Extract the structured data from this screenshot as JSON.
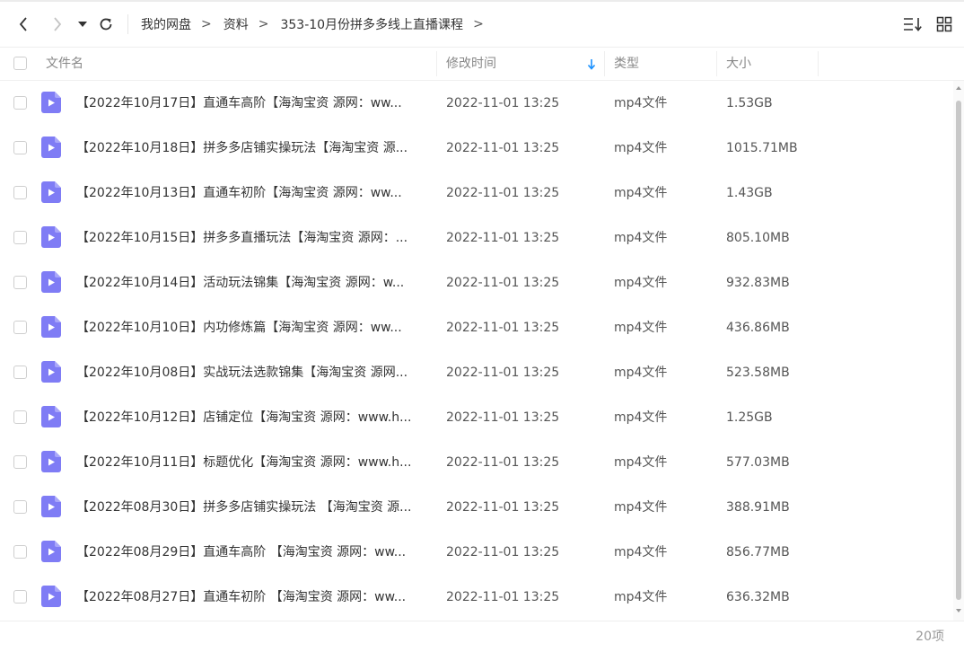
{
  "breadcrumb": [
    "我的网盘",
    "资料",
    "353-10月份拼多多线上直播课程"
  ],
  "breadcrumb_separator": ">",
  "columns": {
    "name": "文件名",
    "modified": "修改时间",
    "type": "类型",
    "size": "大小"
  },
  "sort": {
    "column": "modified",
    "direction": "descending"
  },
  "colors": {
    "accent": "#1890ff",
    "file_icon": "#7f7cf5",
    "text": "#333333",
    "muted": "#888888"
  },
  "icons": {
    "back": "chevron-left-icon",
    "forward": "chevron-right-icon",
    "history": "caret-down-icon",
    "refresh": "refresh-icon",
    "sort": "sort-list-icon",
    "view": "grid-view-icon",
    "file": "video-file-icon"
  },
  "files": [
    {
      "name": "【2022年10月17日】直通车高阶【海淘宝资 源网：ww...",
      "modified": "2022-11-01 13:25",
      "type": "mp4文件",
      "size": "1.53GB"
    },
    {
      "name": "【2022年10月18日】拼多多店铺实操玩法【海淘宝资 源...",
      "modified": "2022-11-01 13:25",
      "type": "mp4文件",
      "size": "1015.71MB"
    },
    {
      "name": "【2022年10月13日】直通车初阶【海淘宝资 源网：ww...",
      "modified": "2022-11-01 13:25",
      "type": "mp4文件",
      "size": "1.43GB"
    },
    {
      "name": "【2022年10月15日】拼多多直播玩法【海淘宝资 源网：...",
      "modified": "2022-11-01 13:25",
      "type": "mp4文件",
      "size": "805.10MB"
    },
    {
      "name": "【2022年10月14日】活动玩法锦集【海淘宝资 源网：w...",
      "modified": "2022-11-01 13:25",
      "type": "mp4文件",
      "size": "932.83MB"
    },
    {
      "name": "【2022年10月10日】内功修炼篇【海淘宝资 源网：ww...",
      "modified": "2022-11-01 13:25",
      "type": "mp4文件",
      "size": "436.86MB"
    },
    {
      "name": "【2022年10月08日】实战玩法选款锦集【海淘宝资 源网...",
      "modified": "2022-11-01 13:25",
      "type": "mp4文件",
      "size": "523.58MB"
    },
    {
      "name": "【2022年10月12日】店铺定位【海淘宝资 源网：www.h...",
      "modified": "2022-11-01 13:25",
      "type": "mp4文件",
      "size": "1.25GB"
    },
    {
      "name": "【2022年10月11日】标题优化【海淘宝资 源网：www.h...",
      "modified": "2022-11-01 13:25",
      "type": "mp4文件",
      "size": "577.03MB"
    },
    {
      "name": "【2022年08月30日】拼多多店铺实操玩法 【海淘宝资 源...",
      "modified": "2022-11-01 13:25",
      "type": "mp4文件",
      "size": "388.91MB"
    },
    {
      "name": "【2022年08月29日】直通车高阶 【海淘宝资 源网：ww...",
      "modified": "2022-11-01 13:25",
      "type": "mp4文件",
      "size": "856.77MB"
    },
    {
      "name": "【2022年08月27日】直通车初阶 【海淘宝资 源网：ww...",
      "modified": "2022-11-01 13:25",
      "type": "mp4文件",
      "size": "636.32MB"
    }
  ],
  "footer": {
    "item_count": "20项"
  }
}
